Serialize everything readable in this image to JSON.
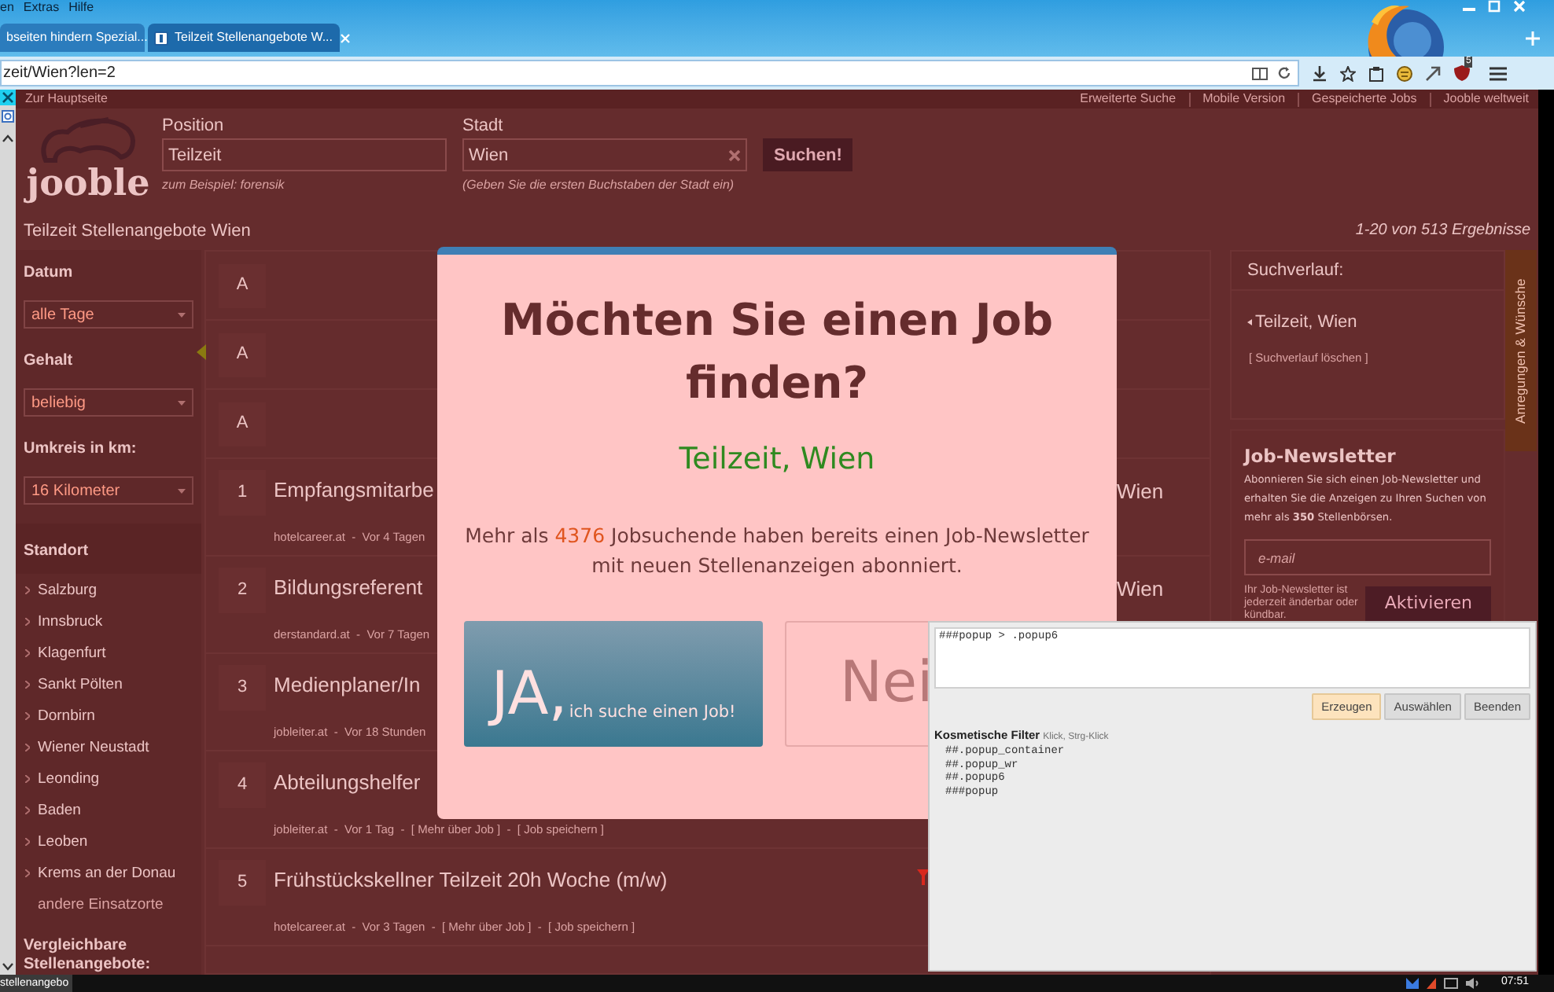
{
  "browser": {
    "menu": [
      "en",
      "Extras",
      "Hilfe"
    ],
    "tabs": [
      {
        "label": "bseiten hindern Spezial...",
        "selected": false
      },
      {
        "label": "Teilzeit Stellenangebote W...",
        "selected": true
      }
    ],
    "address": "zeit/Wien?len=2",
    "addon_badge": "5"
  },
  "topbar": {
    "home_link": "Zur Hauptseite",
    "links": [
      "Erweiterte Suche",
      "Mobile Version",
      "Gespeicherte Jobs",
      "Jooble weltweit"
    ]
  },
  "logo": "jooble",
  "search": {
    "fields": [
      {
        "label": "Position",
        "value": "Teilzeit",
        "hint": "zum Beispiel: forensik",
        "clearable": false
      },
      {
        "label": "Stadt",
        "value": "Wien",
        "hint": "(Geben Sie die ersten Buchstaben der Stadt ein)",
        "clearable": true
      }
    ],
    "button": "Suchen!"
  },
  "results_title": "Teilzeit Stellenangebote Wien",
  "results_count": "1-20 von 513 Ergebnisse",
  "filters": [
    {
      "label": "Datum",
      "value": "alle Tage"
    },
    {
      "label": "Gehalt",
      "value": "beliebig"
    },
    {
      "label": "Umkreis in km:",
      "value": "16 Kilometer"
    }
  ],
  "locations": {
    "title": "Standort",
    "items": [
      "Salzburg",
      "Innsbruck",
      "Klagenfurt",
      "Sankt Pölten",
      "Dornbirn",
      "Wiener Neustadt",
      "Leonding",
      "Baden",
      "Leoben",
      "Krems an der Donau"
    ],
    "more": "andere Einsatzorte"
  },
  "similar_title": "Vergleichbare Stellenangebote:",
  "ads": [
    "A",
    "A",
    "A"
  ],
  "jobs": [
    {
      "number": "1",
      "title": "Empfangsmitarbe",
      "location": "Wien",
      "meta": "hotelcareer.at  -  Vor 4 Tagen",
      "flagged": false
    },
    {
      "number": "2",
      "title": "Bildungsreferent",
      "location": "Wien",
      "meta": "derstandard.at  -  Vor 7 Tagen",
      "flagged": false
    },
    {
      "number": "3",
      "title": "Medienplaner/In",
      "meta": "jobleiter.at  -  Vor 18 Stunden",
      "flagged": false
    },
    {
      "number": "4",
      "title": "Abteilungshelfer",
      "meta": "jobleiter.at  -  Vor 1 Tag  -  [ Mehr über Job ]  -  [ Job speichern ]",
      "flagged": false
    },
    {
      "number": "5",
      "title": "Frühstückskellner Teilzeit 20h Woche (m/w)",
      "meta": "hotelcareer.at  -  Vor 3 Tagen  -  [ Mehr über Job ]  -  [ Job speichern ]",
      "flagged": true
    }
  ],
  "history": {
    "title": "Suchverlauf:",
    "items": [
      "Teilzeit, Wien"
    ],
    "clear": "[ Suchverlauf löschen ]"
  },
  "newsletter": {
    "title": "Job-Newsletter",
    "text": "Abonnieren Sie sich einen Job-Newsletter und erhalten Sie die Anzeigen zu Ihren Suchen von mehr als **350** Stellenbörsen.",
    "placeholder": "e-mail",
    "note": "Ihr Job-Newsletter ist jederzeit änderbar oder kündbar.",
    "button": "Aktivieren"
  },
  "feedback_tab": "Anregungen & Wünsche",
  "modal": {
    "title": "Möchten Sie einen Job finden?",
    "query": "Teilzeit, Wien",
    "text_before": "Mehr als",
    "count": "4376",
    "text_after": "Jobsuchende haben bereits einen Job-Newsletter mit neuen Stellenanzeigen abonniert.",
    "yes_big": "JA,",
    "yes_small": "ich suche einen Job!",
    "no": "Nei"
  },
  "picker": {
    "selector": "###popup > .popup6",
    "buttons": [
      {
        "label": "Erzeugen",
        "selected": true
      },
      {
        "label": "Auswählen",
        "selected": false
      },
      {
        "label": "Beenden",
        "selected": false
      }
    ],
    "filters_title": "Kosmetische Filter",
    "filters_hint": "Klick, Strg-Klick",
    "filters": [
      "##.popup_container",
      "##.popup_wr",
      "##.popup6",
      "###popup"
    ]
  },
  "taskbar": {
    "item": "stellenangebo",
    "time": "07:51"
  }
}
